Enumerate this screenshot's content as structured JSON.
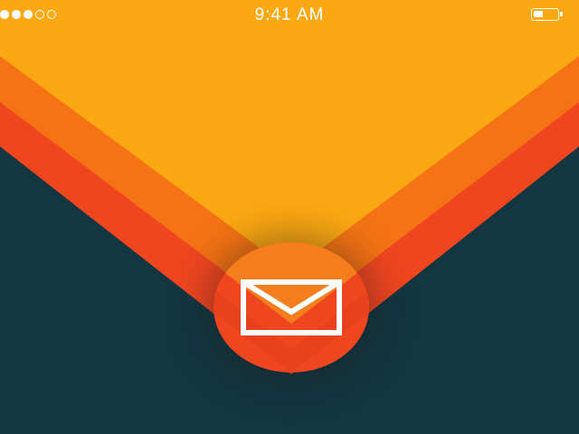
{
  "status_bar": {
    "signal_strength": 3,
    "signal_max": 5,
    "time": "9:41 AM",
    "battery_level": 0.4
  },
  "mail_button": {
    "icon": "envelope-icon"
  },
  "colors": {
    "top_yellow": "#FBA812",
    "stripe_orange": "#F57314",
    "stripe_red": "#F04620",
    "background_dark": "#143641",
    "button_fill": "#F04620",
    "button_top": "#F57E1C"
  }
}
